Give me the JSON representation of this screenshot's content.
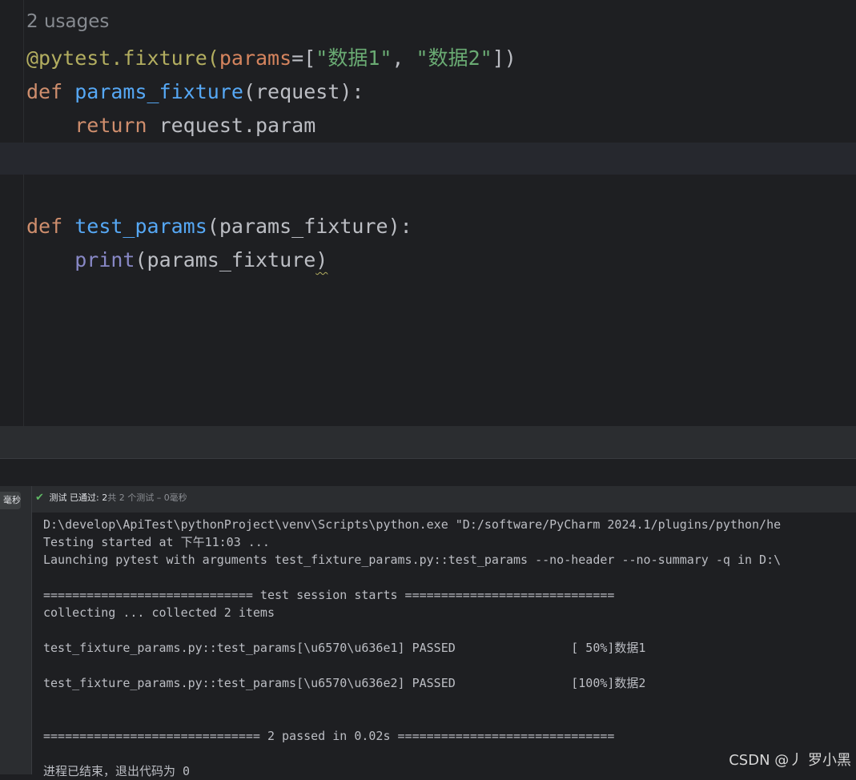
{
  "editor": {
    "usages_hint": "2 usages",
    "line1": {
      "decorator": "@pytest.fixture",
      "open_paren": "(",
      "param_name": "params",
      "equals_bracket": "=[",
      "str1": "\"数据1\"",
      "comma": ", ",
      "str2": "\"数据2\"",
      "close": "])"
    },
    "line2": {
      "kw": "def ",
      "fn": "params_fixture",
      "rest": "(request):"
    },
    "line3": {
      "indent": "    ",
      "kw": "return ",
      "rest": "request.param"
    },
    "line4": {
      "kw": "def ",
      "fn": "test_params",
      "rest": "(params_fixture):"
    },
    "line5": {
      "indent": "    ",
      "builtin": "print",
      "rest": "(params_fixture",
      "close": ")"
    }
  },
  "run_panel": {
    "duration_chip": "毫秒",
    "status": {
      "check_icon": "check-icon",
      "label": "测试 已通过: ",
      "count": "2",
      "detail": "共 2 个测试 – 0毫秒"
    },
    "console_lines": [
      "D:\\develop\\ApiTest\\pythonProject\\venv\\Scripts\\python.exe \"D:/software/PyCharm 2024.1/plugins/python/he",
      "Testing started at 下午11:03 ...",
      "Launching pytest with arguments test_fixture_params.py::test_params --no-header --no-summary -q in D:\\",
      "",
      "============================= test session starts =============================",
      "collecting ... collected 2 items",
      "",
      "test_fixture_params.py::test_params[\\u6570\\u636e1] PASSED                [ 50%]数据1",
      "",
      "test_fixture_params.py::test_params[\\u6570\\u636e2] PASSED                [100%]数据2",
      "",
      "",
      "============================== 2 passed in 0.02s ==============================",
      "",
      "进程已结束，退出代码为 0"
    ]
  },
  "watermark": "CSDN @丿 罗小黑",
  "colors": {
    "background": "#1e1f22",
    "keyword": "#cf8e6d",
    "function": "#56a8f5",
    "string": "#6aab73",
    "decorator": "#b3ae60",
    "pass_green": "#5fb865"
  }
}
